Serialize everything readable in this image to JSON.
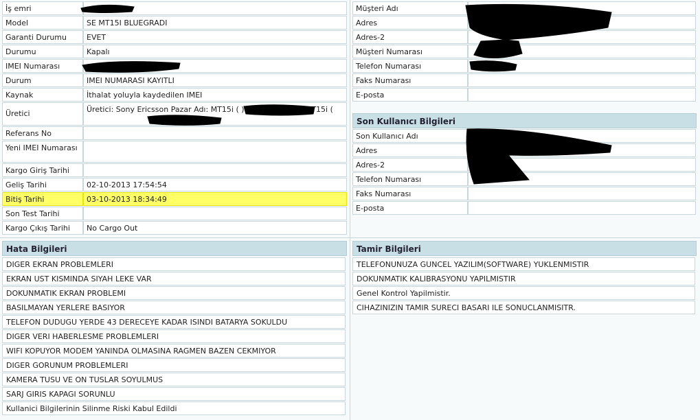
{
  "order_fields": [
    {
      "label": "İş emri",
      "value": ""
    },
    {
      "label": "Model",
      "value": "SE MT15I BLUEGRADI"
    },
    {
      "label": "Garanti Durumu",
      "value": "EVET"
    },
    {
      "label": "Durumu",
      "value": "Kapalı"
    },
    {
      "label": "IMEI Numarası",
      "value": ""
    },
    {
      "label": "Durum",
      "value": "IMEI NUMARASI KAYITLI"
    },
    {
      "label": "Kaynak",
      "value": "İthalat yoluyla kaydedilen IMEI"
    },
    {
      "label": "Üretici",
      "value": "Üretici: Sony Ericsson Pazar Adı: MT15i (                ) Model Bilgileri: MT15i ("
    },
    {
      "label": "Referans No",
      "value": ""
    },
    {
      "label": "Yeni IMEI Numarası",
      "value": ""
    },
    {
      "label": "Kargo Giriş Tarihi",
      "value": ""
    },
    {
      "label": "Geliş Tarihi",
      "value": "02-10-2013 17:54:54"
    },
    {
      "label": "Bitiş Tarihi",
      "value": "03-10-2013 18:34:49"
    },
    {
      "label": "Son Test Tarihi",
      "value": ""
    },
    {
      "label": "Kargo Çıkış Tarihi",
      "value": "No Cargo Out"
    }
  ],
  "customer_fields": [
    {
      "label": "Müşteri Adı",
      "value": ""
    },
    {
      "label": "Adres",
      "value": ""
    },
    {
      "label": "Adres-2",
      "value": ""
    },
    {
      "label": "Müşteri Numarası",
      "value": ""
    },
    {
      "label": "Telefon Numarası",
      "value": ""
    },
    {
      "label": "Faks Numarası",
      "value": ""
    },
    {
      "label": "E-posta",
      "value": ""
    }
  ],
  "end_user": {
    "title": "Son Kullanıcı Bilgileri",
    "fields": [
      {
        "label": "Son Kullanıcı Adı",
        "value": ""
      },
      {
        "label": "Adres",
        "value": ""
      },
      {
        "label": "Adres-2",
        "value": ""
      },
      {
        "label": "Telefon Numarası",
        "value": ""
      },
      {
        "label": "Faks Numarası",
        "value": ""
      },
      {
        "label": "E-posta",
        "value": ""
      }
    ]
  },
  "errors": {
    "title": "Hata Bilgileri",
    "items": [
      "DIGER EKRAN PROBLEMLERI",
      "EKRAN UST KISMINDA SIYAH LEKE VAR",
      "DOKUNMATIK EKRAN PROBLEMI",
      "BASILMAYAN YERLERE BASIYOR",
      "TELEFON DUDUGU YERDE 43 DERECEYE KADAR ISINDI BATARYA SOKULDU",
      "DIGER VERI HABERLESME PROBLEMLERI",
      "WIFI KOPUYOR MODEM YANINDA OLMASINA RAGMEN BAZEN CEKMIYOR",
      "DIGER GORUNUM PROBLEMLERI",
      "KAMERA TUSU VE ON TUSLAR SOYULMUS",
      "SARJ GIRIS KAPAGI SORUNLU",
      "Kullanici Bilgilerinin Silinme Riski Kabul Edildi"
    ]
  },
  "repairs": {
    "title": "Tamir Bilgileri",
    "items": [
      "TELEFONUNUZA GUNCEL YAZILIM(SOFTWARE) YUKLENMISTIR",
      "DOKUNMATIK KALIBRASYONU YAPILMISTIR",
      "Genel Kontrol Yapilmistir.",
      "CIHAZINIZIN TAMIR SURECI BASARI ILE SONUCLANMISITR."
    ]
  },
  "colors": {
    "highlight": "#ffff66",
    "header_bg": "#c9dfe6",
    "redaction": "#000000"
  }
}
